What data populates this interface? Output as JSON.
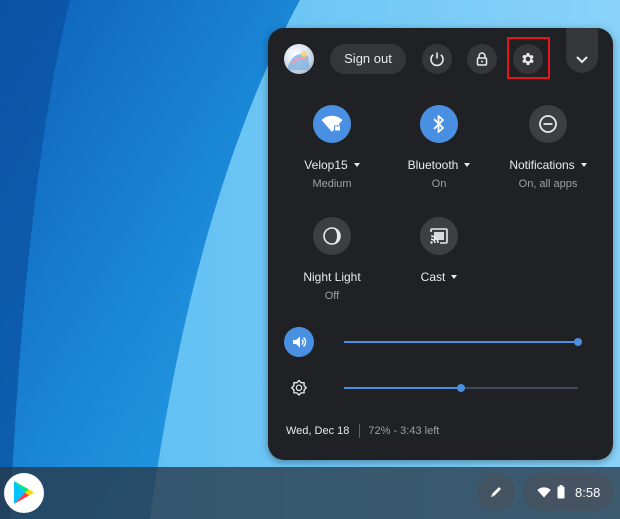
{
  "header": {
    "signout_label": "Sign out"
  },
  "tiles": [
    {
      "label": "Velop15",
      "sub": "Medium",
      "icon": "wifi-locked-icon",
      "state": "on"
    },
    {
      "label": "Bluetooth",
      "sub": "On",
      "icon": "bluetooth-icon",
      "state": "on"
    },
    {
      "label": "Notifications",
      "sub": "On, all apps",
      "icon": "do-not-disturb-icon",
      "state": "off"
    },
    {
      "label": "Night Light",
      "sub": "Off",
      "icon": "night-light-icon",
      "state": "off"
    },
    {
      "label": "Cast",
      "sub": "",
      "icon": "cast-icon",
      "state": "off"
    }
  ],
  "sliders": {
    "volume": {
      "icon": "volume-icon",
      "level": 1.0
    },
    "brightness": {
      "icon": "brightness-icon",
      "level": 0.5
    }
  },
  "footer": {
    "date": "Wed, Dec 18",
    "battery": "72% - 3:43 left"
  },
  "shelf": {
    "time": "8:58"
  },
  "colors": {
    "panel_bg": "#202124",
    "accent": "#4a90e2",
    "highlight": "#e8141b"
  }
}
